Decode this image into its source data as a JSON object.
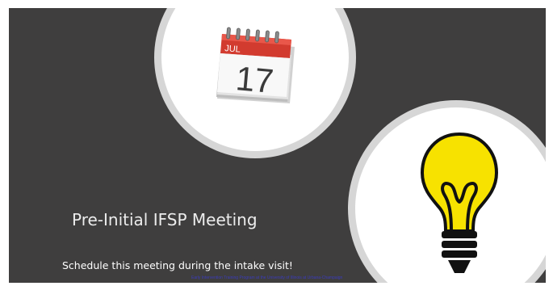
{
  "slide": {
    "title": "Pre-Initial IFSP Meeting",
    "subtitle": "Schedule this meeting during the intake visit!",
    "footer": "Early Intervention Training Program at the University of Illinois at Urbana-Champaign"
  },
  "calendar": {
    "month": "JUL",
    "day": "17"
  },
  "colors": {
    "slide_background": "#3f3e3e",
    "circle_border": "#d6d6d6",
    "calendar_red": "#d23b2f",
    "bulb_yellow": "#f7e200"
  },
  "icons": [
    "calendar-icon",
    "lightbulb-icon"
  ]
}
